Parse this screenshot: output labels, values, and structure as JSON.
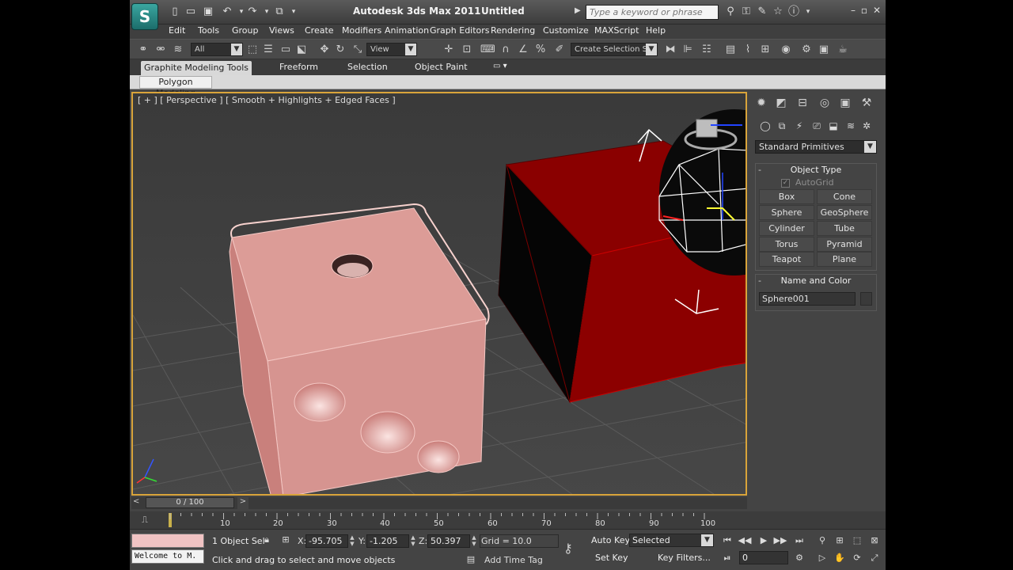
{
  "title": {
    "app": "Autodesk 3ds Max  2011",
    "document": "Untitled",
    "search_placeholder": "Type a keyword or phrase",
    "logo": "S"
  },
  "menu": [
    "Edit",
    "Tools",
    "Group",
    "Views",
    "Create",
    "Modifiers",
    "Animation",
    "Graph Editors",
    "Rendering",
    "Customize",
    "MAXScript",
    "Help"
  ],
  "toolbar": {
    "selection_filter": "All",
    "reference_coord": "View",
    "named_selection_placeholder": "Create Selection Se"
  },
  "ribbon": {
    "tabs": [
      "Graphite Modeling Tools",
      "Freeform",
      "Selection",
      "Object Paint"
    ],
    "panel_tab": "Polygon Modeling"
  },
  "viewport": {
    "label": "[ + ] [ Perspective ] [ Smooth + Highlights + Edged Faces ]"
  },
  "command_panel": {
    "category": "Standard Primitives",
    "object_type_header": "Object Type",
    "autogrid_label": "AutoGrid",
    "buttons": [
      "Box",
      "Cone",
      "Sphere",
      "GeoSphere",
      "Cylinder",
      "Tube",
      "Torus",
      "Pyramid",
      "Teapot",
      "Plane"
    ],
    "name_color_header": "Name and Color",
    "object_name": "Sphere001"
  },
  "time_slider": {
    "position": "0 / 100",
    "ticks": [
      "10",
      "20",
      "30",
      "40",
      "50",
      "60",
      "70",
      "80",
      "90",
      "100"
    ]
  },
  "status": {
    "listener_text": "Welcome to M.",
    "selection_info": "1 Object Sel",
    "prompt": "Click and drag to select and move objects",
    "x_label": "X:",
    "x_value": "-95.705",
    "y_label": "Y:",
    "y_value": "-1.205",
    "z_label": "Z:",
    "z_value": "50.397",
    "grid": "Grid = 10.0",
    "add_time_tag": "Add Time Tag",
    "auto_key": "Auto Key",
    "set_key": "Set Key",
    "selection_set": "Selected",
    "key_filters": "Key Filters...",
    "current_frame": "0"
  },
  "colors": {
    "die": "#d99590",
    "box": "#8c0000",
    "viewport_border": "#d9a43a",
    "grid": "#5a5a5a"
  }
}
